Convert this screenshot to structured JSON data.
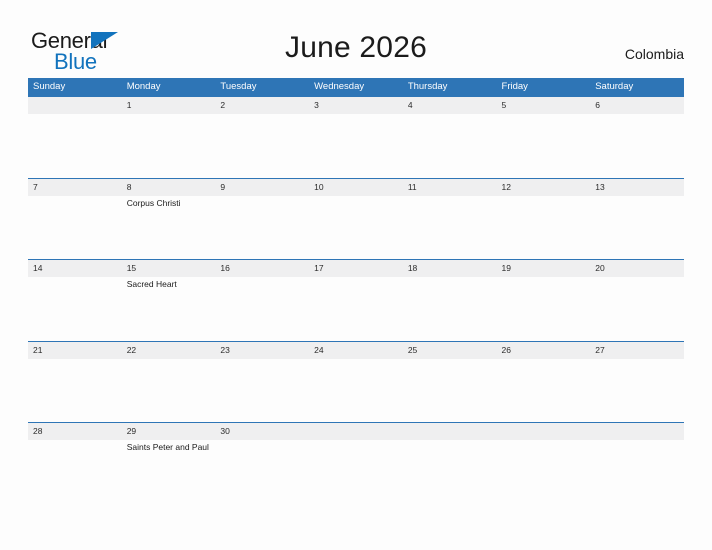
{
  "brand": {
    "name_part1": "General",
    "name_part2": "Blue",
    "triangle_icon": "triangle-icon",
    "accent_color": "#1273bd"
  },
  "header": {
    "title": "June 2026",
    "country": "Colombia"
  },
  "calendar": {
    "header_color": "#2e75b6",
    "date_band_color": "#efeff0",
    "weekdays": [
      "Sunday",
      "Monday",
      "Tuesday",
      "Wednesday",
      "Thursday",
      "Friday",
      "Saturday"
    ],
    "weeks": [
      {
        "days": [
          {
            "date": "",
            "event": ""
          },
          {
            "date": "1",
            "event": ""
          },
          {
            "date": "2",
            "event": ""
          },
          {
            "date": "3",
            "event": ""
          },
          {
            "date": "4",
            "event": ""
          },
          {
            "date": "5",
            "event": ""
          },
          {
            "date": "6",
            "event": ""
          }
        ]
      },
      {
        "days": [
          {
            "date": "7",
            "event": ""
          },
          {
            "date": "8",
            "event": "Corpus Christi"
          },
          {
            "date": "9",
            "event": ""
          },
          {
            "date": "10",
            "event": ""
          },
          {
            "date": "11",
            "event": ""
          },
          {
            "date": "12",
            "event": ""
          },
          {
            "date": "13",
            "event": ""
          }
        ]
      },
      {
        "days": [
          {
            "date": "14",
            "event": ""
          },
          {
            "date": "15",
            "event": "Sacred Heart"
          },
          {
            "date": "16",
            "event": ""
          },
          {
            "date": "17",
            "event": ""
          },
          {
            "date": "18",
            "event": ""
          },
          {
            "date": "19",
            "event": ""
          },
          {
            "date": "20",
            "event": ""
          }
        ]
      },
      {
        "days": [
          {
            "date": "21",
            "event": ""
          },
          {
            "date": "22",
            "event": ""
          },
          {
            "date": "23",
            "event": ""
          },
          {
            "date": "24",
            "event": ""
          },
          {
            "date": "25",
            "event": ""
          },
          {
            "date": "26",
            "event": ""
          },
          {
            "date": "27",
            "event": ""
          }
        ]
      },
      {
        "days": [
          {
            "date": "28",
            "event": ""
          },
          {
            "date": "29",
            "event": "Saints Peter and Paul"
          },
          {
            "date": "30",
            "event": ""
          },
          {
            "date": "",
            "event": ""
          },
          {
            "date": "",
            "event": ""
          },
          {
            "date": "",
            "event": ""
          },
          {
            "date": "",
            "event": ""
          }
        ]
      }
    ]
  }
}
